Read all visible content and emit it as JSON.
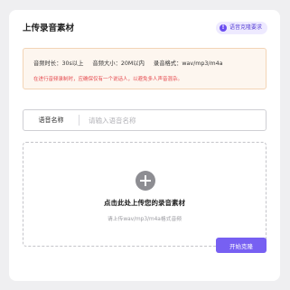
{
  "header": {
    "title": "上传录音素材",
    "requirements_link": "语音克隆要求"
  },
  "notice": {
    "specs": [
      "音频时长：30s以上",
      "音频大小：20M以内",
      "录音格式：wav/mp3/m4a"
    ],
    "warning": "在进行音频录制时，应确保仅有一个说话人，以避免多人声音混杂。"
  },
  "name_field": {
    "label": "语音名称",
    "placeholder": "请输入语音名称",
    "value": ""
  },
  "upload": {
    "title": "点击此处上传您的录音素材",
    "hint": "请上传wav/mp3/m4a格式音频"
  },
  "actions": {
    "start_label": "开始克隆"
  },
  "colors": {
    "accent": "#7760f2",
    "warning": "#e5484d",
    "notice_bg": "#fdf6ef"
  },
  "icons": {
    "info": "info-icon",
    "upload": "plus-circle-icon"
  }
}
